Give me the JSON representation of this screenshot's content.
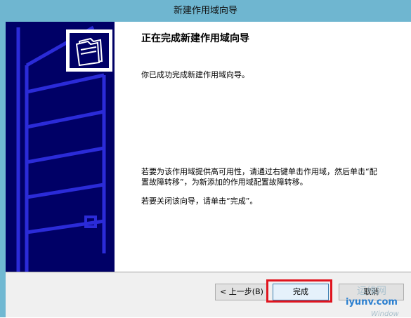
{
  "window": {
    "title": "新建作用域向导"
  },
  "wizard": {
    "heading": "正在完成新建作用域向导",
    "success_text": "你已成功完成新建作用域向导。",
    "failover_text": "若要为该作用域提供高可用性，请通过右键单击作用域，然后单击“配置故障转移”，为新添加的作用域配置故障转移。",
    "close_text": "若要关闭该向导，请单击“完成”。"
  },
  "buttons": {
    "back": "< 上一步(B)",
    "finish": "完成",
    "cancel": "取消"
  },
  "watermark": {
    "cn": "运维网",
    "url": "iyunv.com",
    "faint": "Window"
  },
  "colors": {
    "banner": "#000066",
    "highlight": "#e0141e",
    "titlebar": "#6fb6d0"
  },
  "icons": {
    "wizard": "folders-icon"
  }
}
